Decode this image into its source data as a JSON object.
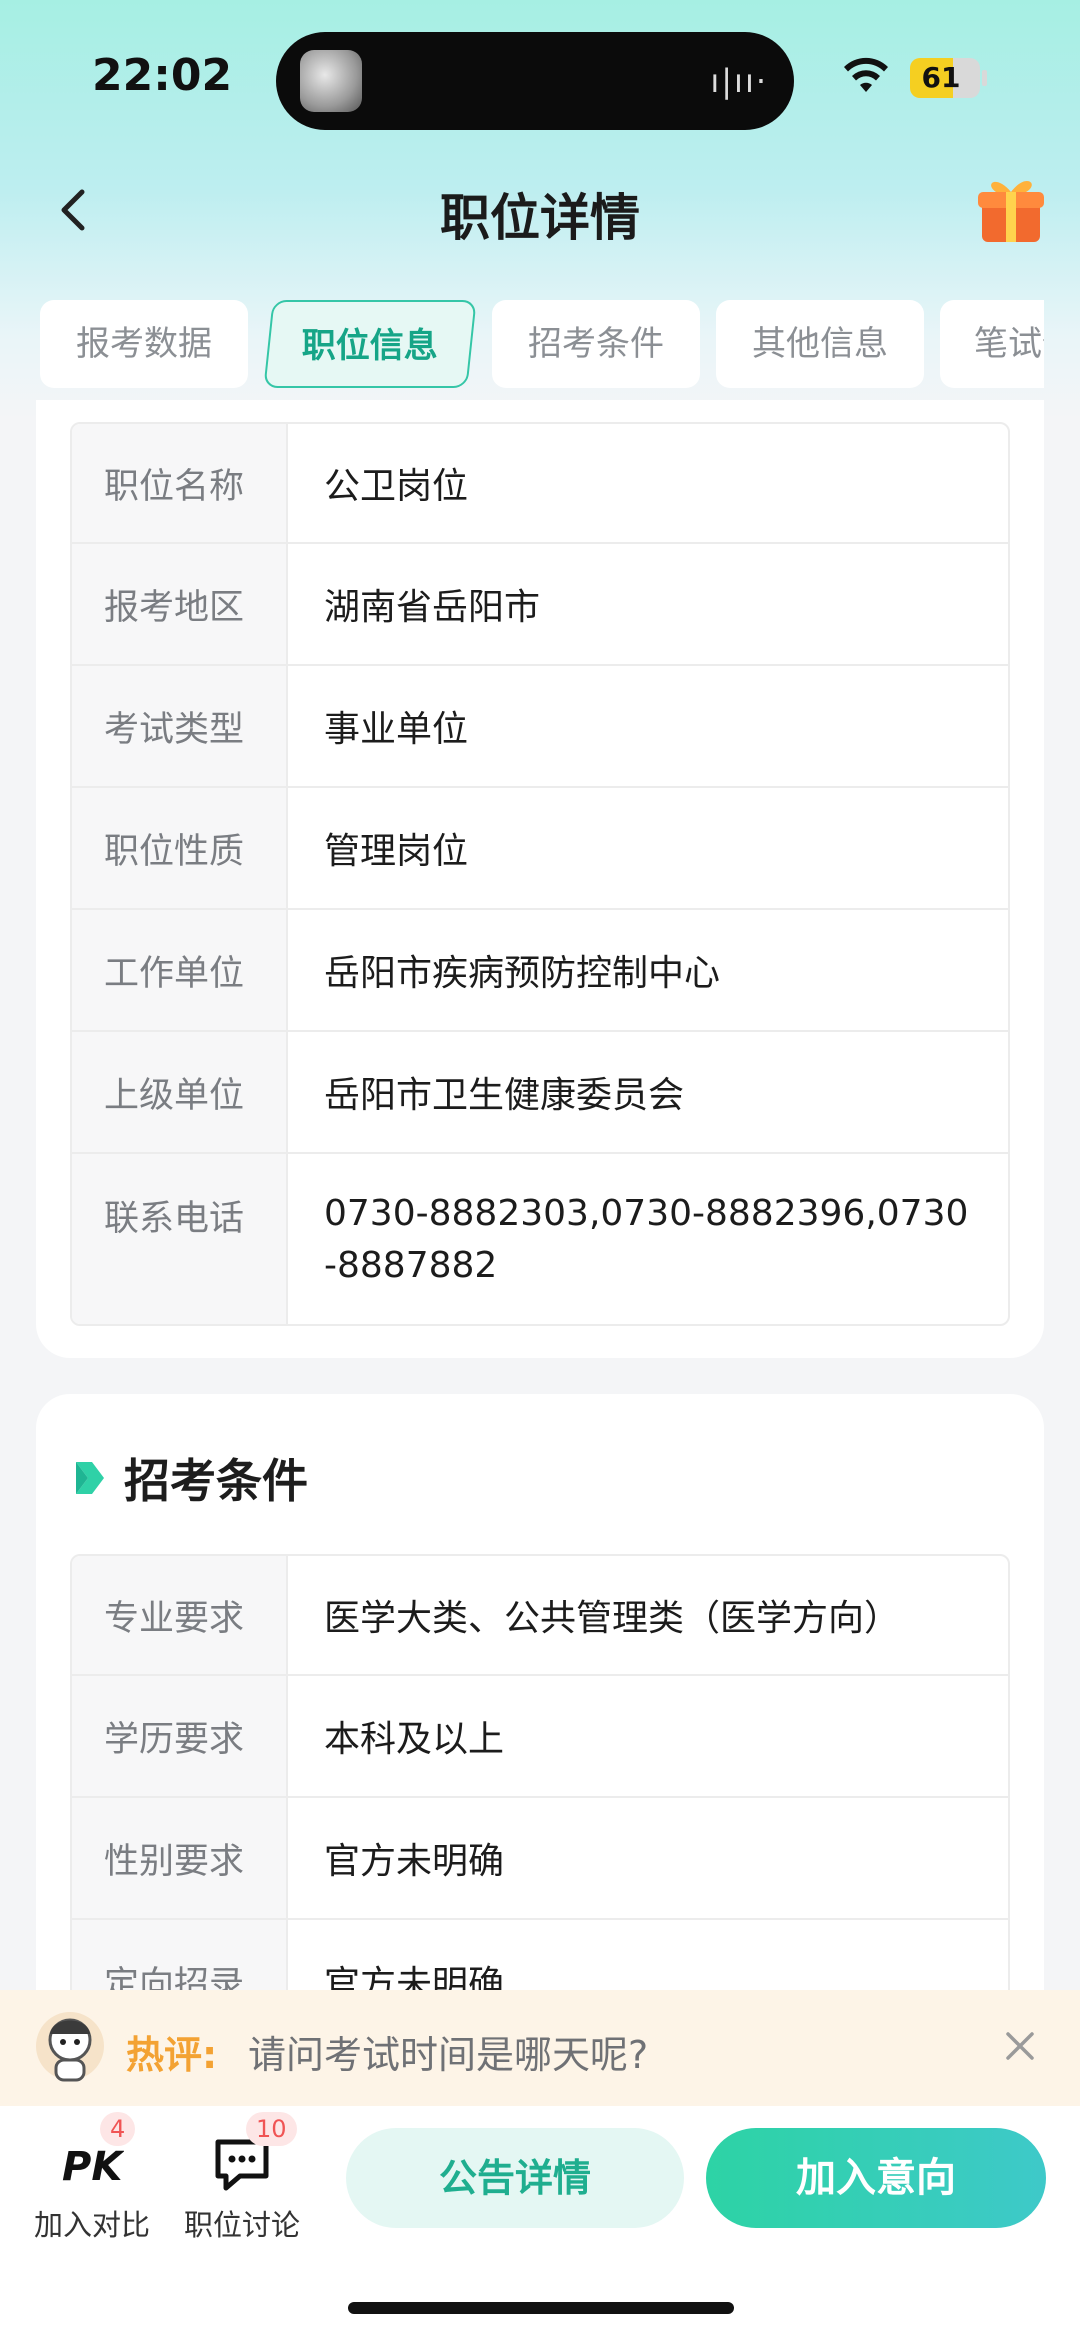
{
  "status_bar": {
    "time": "22:02",
    "battery": "61",
    "battery_level": 0.61
  },
  "nav": {
    "title": "职位详情"
  },
  "tabs": [
    {
      "label": "报考数据"
    },
    {
      "label": "职位信息"
    },
    {
      "label": "招考条件"
    },
    {
      "label": "其他信息"
    },
    {
      "label": "笔试信息"
    }
  ],
  "position_info": {
    "rows": [
      {
        "label": "职位名称",
        "value": "公卫岗位"
      },
      {
        "label": "报考地区",
        "value": "湖南省岳阳市"
      },
      {
        "label": "考试类型",
        "value": "事业单位"
      },
      {
        "label": "职位性质",
        "value": "管理岗位"
      },
      {
        "label": "工作单位",
        "value": "岳阳市疾病预防控制中心"
      },
      {
        "label": "上级单位",
        "value": "岳阳市卫生健康委员会"
      },
      {
        "label": "联系电话",
        "value": "0730-8882303,0730-8882396,0730-8887882"
      }
    ]
  },
  "requirements": {
    "title": "招考条件",
    "rows": [
      {
        "label": "专业要求",
        "value": "医学大类、公共管理类（医学方向）"
      },
      {
        "label": "学历要求",
        "value": "本科及以上"
      },
      {
        "label": "性别要求",
        "value": "官方未明确"
      },
      {
        "label": "定向招录",
        "value": "官方未明确"
      }
    ]
  },
  "hot_comment": {
    "label": "热评:",
    "text": "请问考试时间是哪天呢?"
  },
  "bottom_bar": {
    "compare": {
      "label": "加入对比",
      "badge": "4"
    },
    "discuss": {
      "label": "职位讨论",
      "badge": "10"
    },
    "notice_button": "公告详情",
    "join_button": "加入意向"
  },
  "colors": {
    "accent": "#2dd3a5",
    "accent_text": "#16a587",
    "hot": "#f3a233",
    "badge": "#f05454"
  }
}
